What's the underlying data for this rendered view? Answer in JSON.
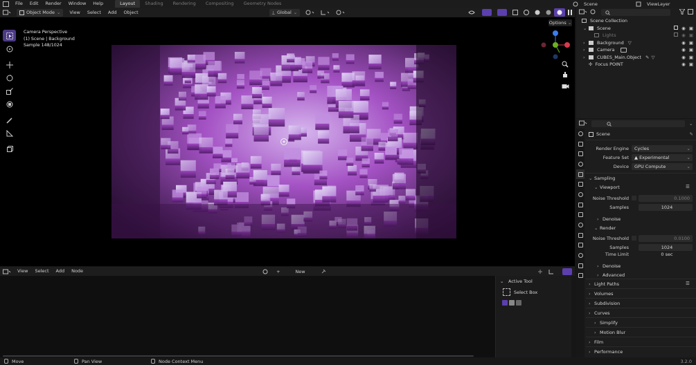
{
  "topbar": {
    "menus": [
      "File",
      "Edit",
      "Render",
      "Window",
      "Help"
    ],
    "workspaces": [
      "Layout",
      "Shading",
      "Rendering",
      "Compositing",
      "Geometry Nodes"
    ],
    "active_workspace": "Layout",
    "scene": "Scene",
    "view_layer": "ViewLayer"
  },
  "viewport_header": {
    "mode": "Object Mode",
    "menus": [
      "View",
      "Select",
      "Add",
      "Object"
    ],
    "transform_orientation": "Global"
  },
  "viewport": {
    "overlay_lines": [
      "Camera Perspective",
      "(1) Scene | Background",
      "Sample 148/1024"
    ],
    "options_label": "Options",
    "gizmo_colors": {
      "x": "#d9394e",
      "y": "#6bb020",
      "z": "#3a7ef0"
    }
  },
  "node_editor": {
    "menus": [
      "View",
      "Select",
      "Add",
      "Node"
    ],
    "new_label": "New",
    "panel_title": "Active Tool",
    "tool_name": "Select Box"
  },
  "outliner": {
    "title": "Scene Collection",
    "items": [
      "Scene",
      "Lights",
      "Background",
      "Camera",
      "CUBES_Main.Object",
      "Focus POINT"
    ]
  },
  "properties": {
    "header": "Scene",
    "render_engine_label": "Render Engine",
    "render_engine": "Cycles",
    "feature_set_label": "Feature Set",
    "feature_set": "Experimental",
    "device_label": "Device",
    "device": "GPU Compute",
    "sampling": {
      "title": "Sampling",
      "viewport": {
        "title": "Viewport",
        "noise_threshold_label": "Noise Threshold",
        "noise_threshold": "0.1000",
        "samples_label": "Samples",
        "samples": "1024",
        "denoise": "Denoise"
      },
      "render": {
        "title": "Render",
        "noise_threshold_label": "Noise Threshold",
        "noise_threshold": "0.0100",
        "samples_label": "Samples",
        "samples": "1024",
        "time_limit_label": "Time Limit",
        "time_limit": "0 sec",
        "denoise": "Denoise"
      },
      "advanced": "Advanced"
    },
    "panels": [
      "Light Paths",
      "Volumes",
      "Subdivision",
      "Curves",
      "Simplify",
      "Motion Blur",
      "Film",
      "Performance"
    ]
  },
  "statusbar": {
    "items": [
      "Move",
      "Pan View",
      "Node Context Menu"
    ],
    "version": "3.2.0"
  },
  "colors": {
    "accent": "#4c3a87",
    "render_purple": "#b24fd6"
  }
}
